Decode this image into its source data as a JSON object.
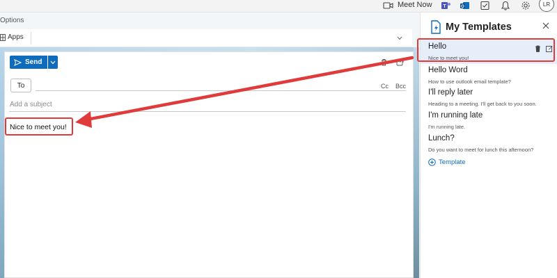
{
  "topbar": {
    "meet_now_label": "Meet Now",
    "avatar_initials": "LR",
    "icons": [
      "video-camera-icon",
      "teams-icon",
      "outlook-icon",
      "tasks-icon",
      "bell-icon",
      "gear-icon"
    ]
  },
  "left": {
    "options_label": "Options",
    "apps_label": "Apps"
  },
  "compose": {
    "send_label": "Send",
    "to_label": "To",
    "cc_label": "Cc",
    "bcc_label": "Bcc",
    "subject_placeholder": "Add a subject",
    "body_text": "Nice to meet you!"
  },
  "templates_panel": {
    "title": "My Templates",
    "add_label": "Template",
    "items": [
      {
        "title": "Hello",
        "text": "Nice to meet you!",
        "selected": true
      },
      {
        "title": "Hello Word",
        "text": "How to use outlook email template?"
      },
      {
        "title": "I'll reply later",
        "text": "Heading to a meeting. I'll get back to you soon."
      },
      {
        "title": "I'm running late",
        "text": "I'm running late."
      },
      {
        "title": "Lunch?",
        "text": "Do you want to meet for lunch this afternoon?"
      }
    ]
  },
  "colors": {
    "accent": "#0f6cbd",
    "annotation": "#e03a3a",
    "selected_bg": "#e6eefa"
  }
}
